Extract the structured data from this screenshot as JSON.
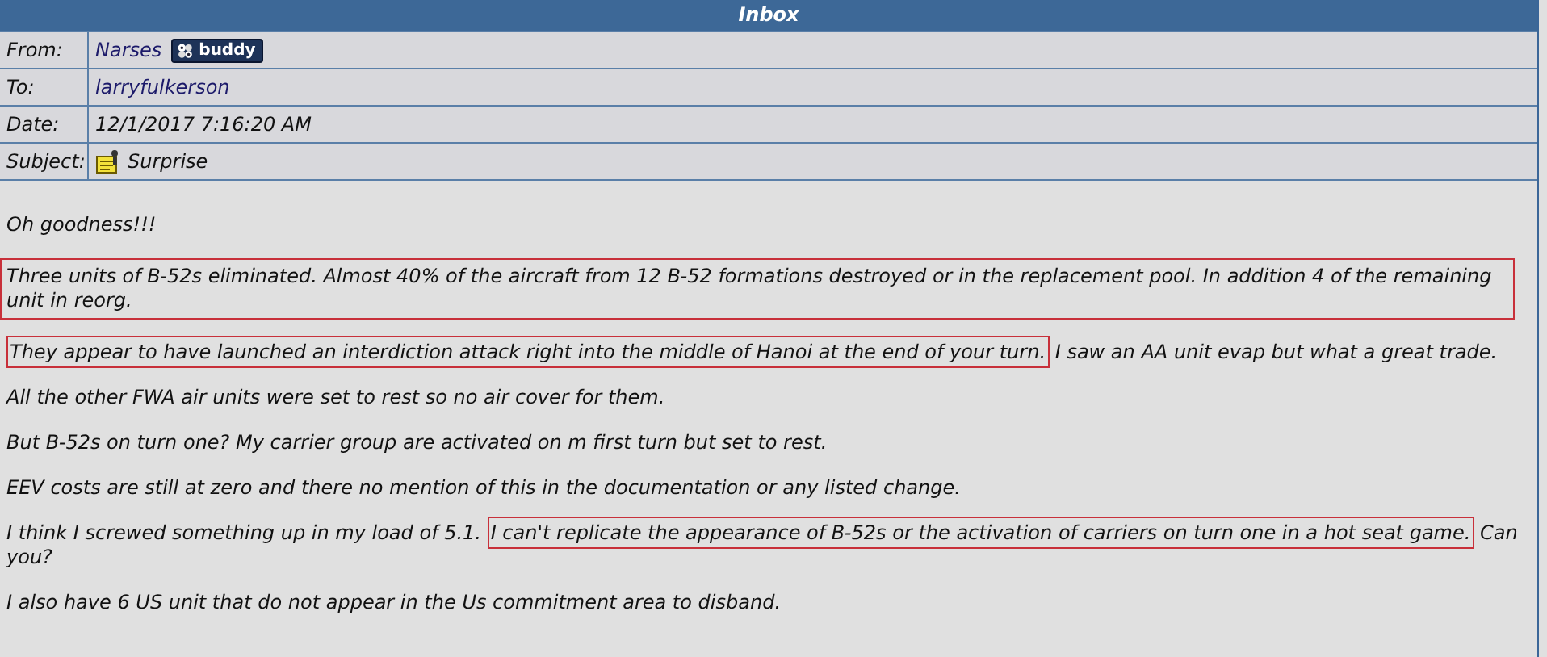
{
  "window": {
    "title": "Inbox"
  },
  "headers": [
    {
      "label": "From:",
      "value": "Narses",
      "kind": "sender",
      "badge": "buddy"
    },
    {
      "label": "To:",
      "value": "larryfulkerson",
      "kind": "link"
    },
    {
      "label": "Date:",
      "value": "12/1/2017 7:16:20 AM",
      "kind": "text"
    },
    {
      "label": "Subject:",
      "value": "Surprise",
      "kind": "subject"
    }
  ],
  "body": [
    {
      "segments": [
        {
          "text": "Oh goodness!!!",
          "highlighted": false
        }
      ]
    },
    {
      "segments": [
        {
          "text": "Three units of B-52s eliminated. Almost 40% of the aircraft from 12 B-52 formations destroyed or in the replacement pool. In addition 4 of the remaining unit in reorg.",
          "highlighted": true
        }
      ]
    },
    {
      "segments": [
        {
          "text": "They appear to have launched an interdiction attack right into the middle of Hanoi at the end of your turn.",
          "highlighted": true
        },
        {
          "text": "I saw an AA unit evap but what a great trade.",
          "highlighted": false
        }
      ]
    },
    {
      "segments": [
        {
          "text": "All the other FWA air units were set to rest so no air cover for them.",
          "highlighted": false
        }
      ]
    },
    {
      "segments": [
        {
          "text": "But B-52s on turn one? My carrier group are activated on m first turn but set to rest.",
          "highlighted": false
        }
      ]
    },
    {
      "segments": [
        {
          "text": "EEV costs are still at zero and there no mention of this in the documentation or any listed change.",
          "highlighted": false
        }
      ]
    },
    {
      "segments": [
        {
          "text": "I think I screwed something up in my load of 5.1.",
          "highlighted": false
        },
        {
          "text": "I can't replicate the appearance of B-52s or the activation of carriers on turn one in a hot seat game.",
          "highlighted": true
        },
        {
          "text": "Can",
          "highlighted": false
        },
        {
          "text": "you?",
          "highlighted": false
        }
      ]
    },
    {
      "segments": [
        {
          "text": "I also have 6 US unit that do not appear in the Us commitment area to disband.",
          "highlighted": false
        }
      ]
    }
  ]
}
